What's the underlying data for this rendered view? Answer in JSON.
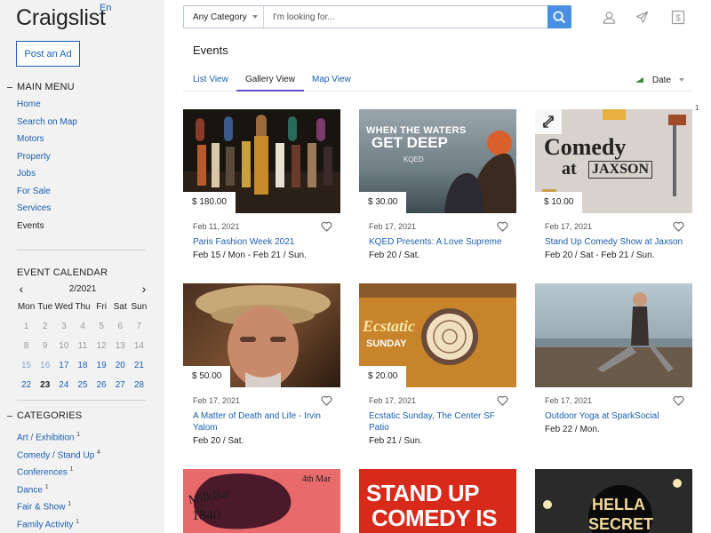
{
  "brand": {
    "logo": "Craigslist",
    "lang": "En"
  },
  "sidebar": {
    "post_ad": "Post an Ad",
    "main_menu_title": "MAIN MENU",
    "main_menu": [
      "Home",
      "Search on Map",
      "Motors",
      "Property",
      "Jobs",
      "For Sale",
      "Services",
      "Events"
    ],
    "calendar_title": "EVENT CALENDAR",
    "calendar": {
      "month": "2/2021",
      "prev": "‹",
      "next": "›",
      "weekdays": [
        "Mon",
        "Tue",
        "Wed",
        "Thu",
        "Fri",
        "Sat",
        "Sun"
      ],
      "days": [
        "1",
        "2",
        "3",
        "4",
        "5",
        "6",
        "7",
        "8",
        "9",
        "10",
        "11",
        "12",
        "13",
        "14",
        "15",
        "16",
        "17",
        "18",
        "19",
        "20",
        "21",
        "22",
        "23",
        "24",
        "25",
        "26",
        "27",
        "28"
      ],
      "today": "23"
    },
    "categories_title": "CATEGORIES",
    "categories": [
      {
        "label": "Art / Exhibition",
        "count": "1"
      },
      {
        "label": "Comedy / Stand Up",
        "count": "4"
      },
      {
        "label": "Conferences",
        "count": "1"
      },
      {
        "label": "Dance",
        "count": "1"
      },
      {
        "label": "Fair & Show",
        "count": "1"
      },
      {
        "label": "Family Activity",
        "count": "1"
      }
    ]
  },
  "search": {
    "category": "Any Category",
    "placeholder": "I'm looking for...",
    "value": ""
  },
  "main": {
    "title": "Events",
    "tabs": [
      "List View",
      "Gallery View",
      "Map View"
    ],
    "sort_label": "Date",
    "edge_count": "1",
    "events": [
      {
        "price": "$ 180.00",
        "posted": "Feb 11, 2021",
        "title": "Paris Fashion Week 2021",
        "range": "Feb 15 / Mon - Feb 21 / Sun."
      },
      {
        "price": "$ 30.00",
        "posted": "Feb 17, 2021",
        "title": "KQED Presents: A Love Supreme",
        "range": "Feb 20 / Sat.",
        "img_text_1": "WHEN THE WATERS",
        "img_text_2": "GET DEEP",
        "img_text_3": "KQED"
      },
      {
        "price": "$ 10.00",
        "posted": "Feb 17, 2021",
        "title": "Stand Up Comedy Show at Jaxson",
        "range": "Feb 20 / Sat - Feb 21 / Sun.",
        "img_text_1": "Comedy",
        "img_text_2": "at",
        "img_text_3": "JAXSON"
      },
      {
        "price": "$ 50.00",
        "posted": "Feb 17, 2021",
        "title": "A Matter of Death and Life - Irvin Yalom",
        "range": "Feb 20 / Sat."
      },
      {
        "price": "$ 20.00",
        "posted": "Feb 17, 2021",
        "title": "Ecstatic Sunday, The Center SF Patio",
        "range": "Feb 21 / Sun.",
        "img_text_1": "Ecstatic",
        "img_text_2": "SUNDAY"
      },
      {
        "price": "",
        "posted": "Feb 17, 2021",
        "title": "Outdoor Yoga at SparkSocial",
        "range": "Feb 22 / Mon."
      },
      {
        "img_text_1": "MilkBar",
        "img_text_2": "1840",
        "img_text_3": "4th Mar"
      },
      {
        "img_text_1": "STAND UP",
        "img_text_2": "COMEDY IS"
      },
      {
        "img_text_1": "HELLA",
        "img_text_2": "SECRET"
      }
    ]
  },
  "colors": {
    "link": "#1a5fb4",
    "accent": "#4a90e2",
    "tab_underline": "#5a4fcf"
  }
}
